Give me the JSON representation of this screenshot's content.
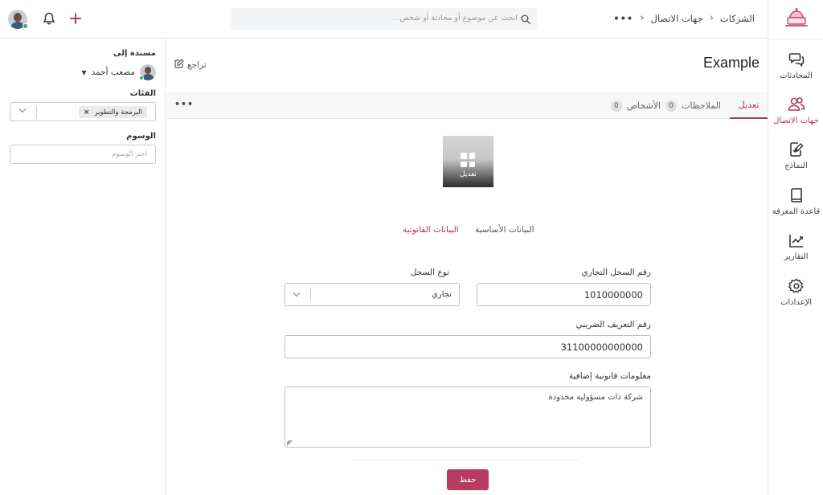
{
  "header": {
    "search_placeholder": "ابحث عن موضوع أو محادثة أو شخص...",
    "breadcrumb": [
      "جهات الاتصال",
      "الشركات"
    ],
    "more_label": "•••"
  },
  "nav": {
    "items": [
      {
        "label": "المحادثات",
        "icon": "chat-icon"
      },
      {
        "label": "جهات الاتصال",
        "icon": "contacts-icon",
        "active": true
      },
      {
        "label": "النماذج",
        "icon": "forms-icon"
      },
      {
        "label": "قاعدة المعرفة",
        "icon": "book-icon"
      },
      {
        "label": "التقارير",
        "icon": "chart-icon"
      },
      {
        "label": "الإعدادات",
        "icon": "gear-icon"
      }
    ]
  },
  "sidebar": {
    "assigned_label": "مسندة إلى",
    "assignee_name": "مصعب أحمد",
    "categories_label": "الفئات",
    "category_chip": "البرمجة والتطوير",
    "tags_label": "الوسوم",
    "tags_placeholder": "اختر الوسوم"
  },
  "main": {
    "title": "Example",
    "review_label": "تراجع",
    "tabs": [
      {
        "label": "تعديل",
        "active": true
      },
      {
        "label": "الملاحظات",
        "count": "0"
      },
      {
        "label": "الأشخاص",
        "count": "0"
      }
    ],
    "tabs_more": "•••",
    "image_label": "تعديل",
    "subtabs": {
      "basic": "البيانات الأساسية",
      "legal": "البيانات القانونية"
    },
    "form": {
      "cr_number_label": "رقم السجل التجاري",
      "cr_number_value": "1010000000",
      "record_type_label": "نوع السجل",
      "record_type_value": "تجاري",
      "tax_id_label": "رقم التعريف الضريبي",
      "tax_id_value": "31100000000000",
      "legal_info_label": "معلومات قانونية إضافية",
      "legal_info_value": "شركة ذات مسؤولية محدودة"
    },
    "save_label": "حفظ"
  },
  "colors": {
    "accent": "#b73b61",
    "online": "#2fb344"
  }
}
